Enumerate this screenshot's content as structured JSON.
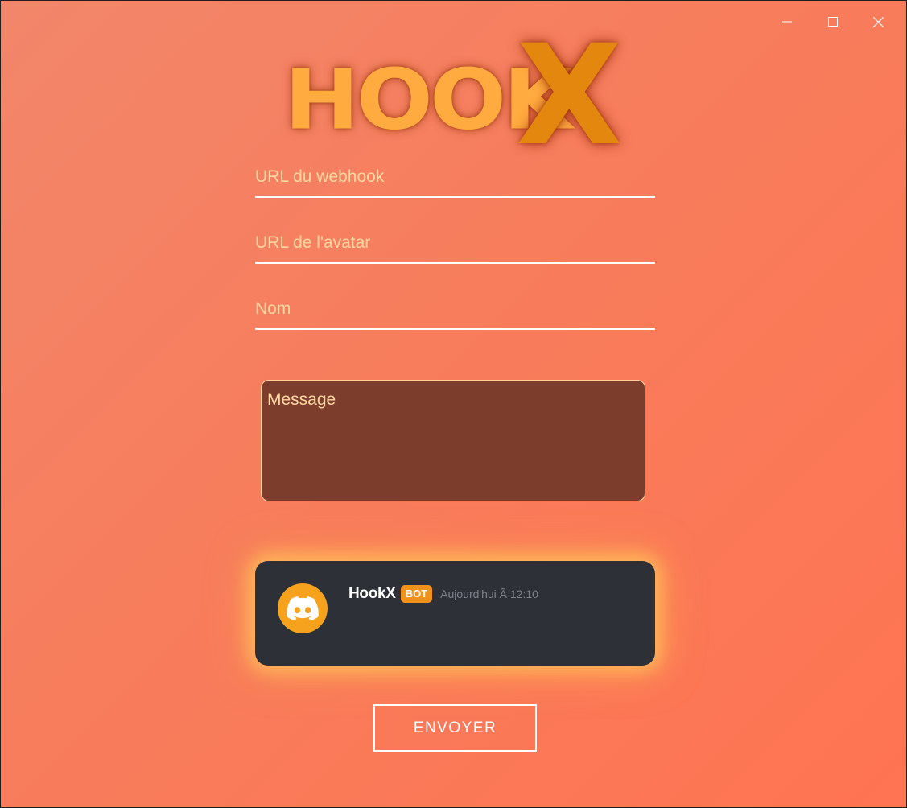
{
  "window": {
    "controls": [
      "minimize-icon",
      "maximize-icon",
      "close-icon"
    ]
  },
  "logo": {
    "text": "HOOK",
    "x": "X",
    "text_color": "#ffab3f",
    "x_color": "#e3870f"
  },
  "form": {
    "webhook_placeholder": "URL du webhook",
    "avatar_placeholder": "URL de l'avatar",
    "name_placeholder": "Nom",
    "message_placeholder": "Message"
  },
  "preview": {
    "avatar_icon": "discord-icon",
    "username": "HookX",
    "badge": "BOT",
    "timestamp": "Aujourd'hui Ã  12:10",
    "card_color": "#2d3036",
    "accent": "#f6a21c"
  },
  "send_button": {
    "label": "ENVOYER"
  },
  "colors": {
    "background_start": "#f2866a",
    "background_end": "#ff7452",
    "textarea_bg": "#7c3d2d"
  }
}
